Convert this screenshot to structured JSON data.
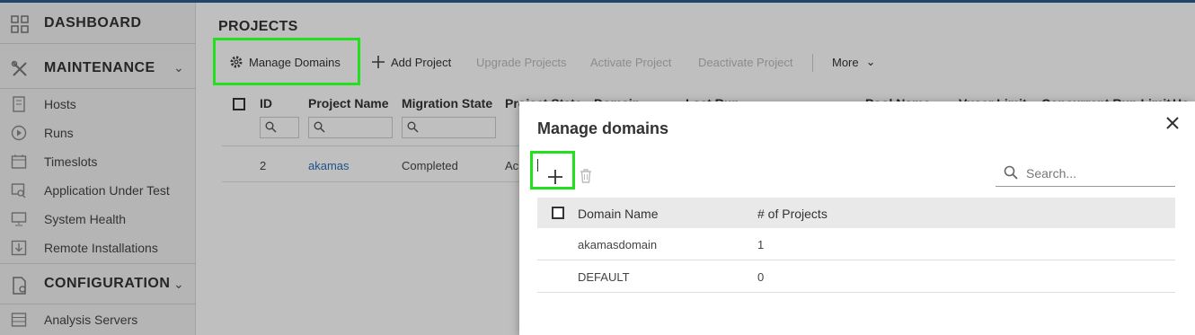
{
  "sidebar": {
    "sections": [
      {
        "label": "DASHBOARD"
      },
      {
        "label": "MAINTENANCE"
      },
      {
        "label": "CONFIGURATION"
      }
    ],
    "items": [
      {
        "label": "Hosts"
      },
      {
        "label": "Runs"
      },
      {
        "label": "Timeslots"
      },
      {
        "label": "Application Under Test"
      },
      {
        "label": "System Health"
      },
      {
        "label": "Remote Installations"
      },
      {
        "label": "Analysis Servers"
      }
    ]
  },
  "main": {
    "title": "PROJECTS",
    "toolbar": {
      "manage_domains": "Manage Domains",
      "add_project": "Add Project",
      "upgrade_projects": "Upgrade Projects",
      "activate_project": "Activate Project",
      "deactivate_project": "Deactivate Project",
      "more": "More"
    },
    "grid": {
      "columns": [
        "ID",
        "Project Name",
        "Migration State",
        "Project State",
        "Domain",
        "Last Run",
        "Pool Name",
        "Vuser Limit",
        "Concurrent Run Limit",
        "Ho"
      ],
      "rows": [
        {
          "id": "2",
          "project_name": "akamas",
          "migration_state": "Completed",
          "project_state": "Ac"
        }
      ]
    }
  },
  "dialog": {
    "title": "Manage domains",
    "search_placeholder": "Search...",
    "columns": {
      "domain_name": "Domain Name",
      "num_projects": "# of Projects"
    },
    "rows": [
      {
        "domain_name": "akamasdomain",
        "num_projects": "1"
      },
      {
        "domain_name": "DEFAULT",
        "num_projects": "0"
      }
    ]
  },
  "colors": {
    "highlight": "#22e01e",
    "link": "#2b6fb6",
    "top_bar": "#2e5d93"
  }
}
